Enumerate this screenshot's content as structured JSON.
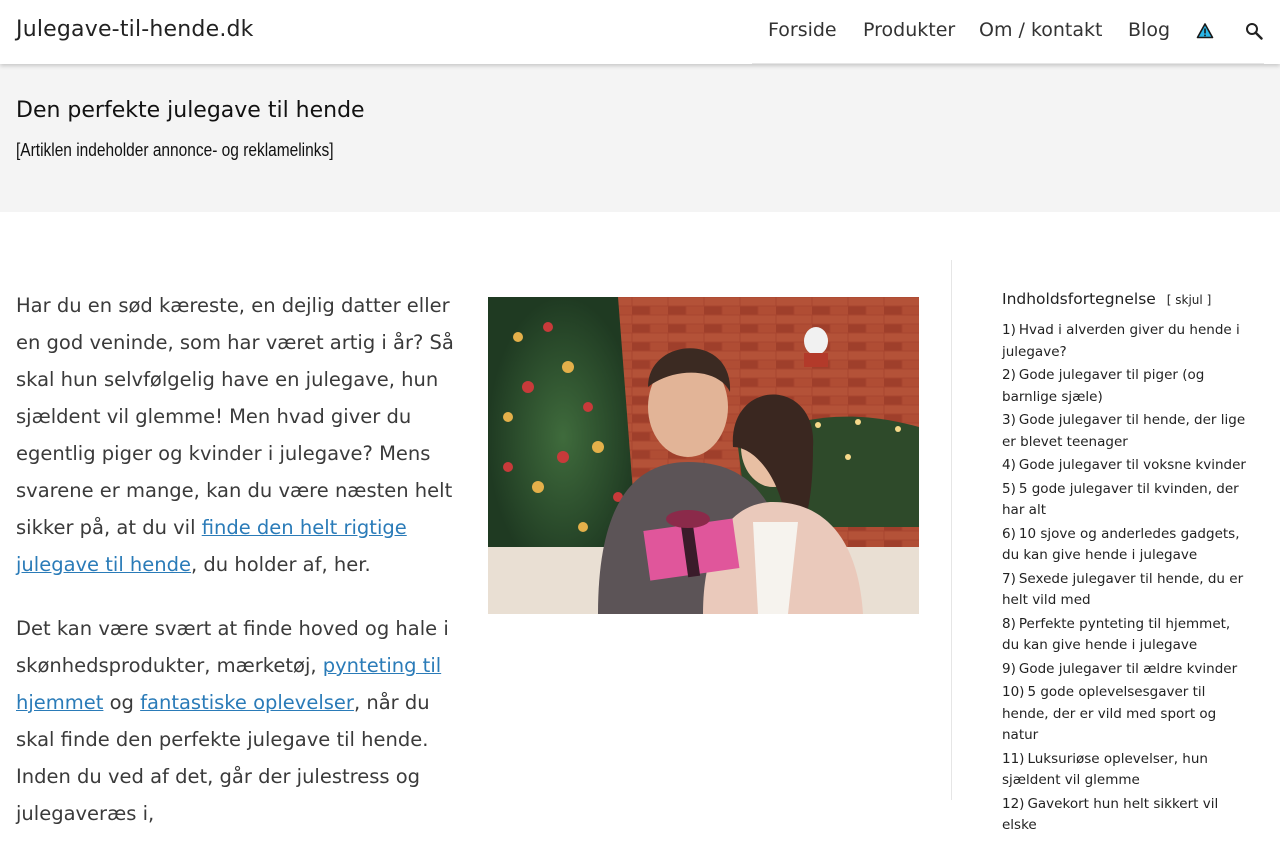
{
  "header": {
    "site_title": "Julegave-til-hende.dk",
    "nav": [
      "Forside",
      "Produkter",
      "Om / kontakt",
      "Blog"
    ],
    "icons": [
      "warning-triangle-icon",
      "search-icon"
    ]
  },
  "hero": {
    "title": "Den perfekte julegave til hende",
    "note": "[Artiklen indeholder annonce- og reklamelinks]"
  },
  "article": {
    "p1_text": "Har du en sød kæreste, en dejlig datter eller en god veninde, som har været artig i år? Så skal hun selvfølgelig have en julegave, hun sjældent vil glemme! Men hvad giver du egentlig piger og kvinder i julegave? Mens svarene er mange, kan du være næsten helt sikker på, at du vil ",
    "p1_link": "finde den helt rigtige julegave til hende",
    "p1_end": ", du holder af, her.",
    "p2_start": "Det kan være svært at finde hoved og hale i skønhedsprodukter, mærketøj, ",
    "p2_link1": "pynteting til hjemmet",
    "p2_mid": " og ",
    "p2_link2": "fantastiske oplevelser",
    "p2_end": ", når du skal finde den perfekte julegave til hende. Inden du ved af det, går der julestress og julegaveræs i,"
  },
  "toc": {
    "title": "Indholdsfortegnelse",
    "toggle_open": "[",
    "toggle_label": "skjul",
    "toggle_close": "]",
    "items": [
      {
        "num": "1)",
        "label": "Hvad i alverden giver du hende i julegave?"
      },
      {
        "num": "2)",
        "label": "Gode julegaver til piger (og barnlige sjæle)"
      },
      {
        "num": "3)",
        "label": "Gode julegaver til hende, der lige er blevet teenager"
      },
      {
        "num": "4)",
        "label": "Gode julegaver til voksne kvinder"
      },
      {
        "num": "5)",
        "label": "5 gode julegaver til kvinden, der har alt"
      },
      {
        "num": "6)",
        "label": "10 sjove og anderledes gadgets, du kan give hende i julegave"
      },
      {
        "num": "7)",
        "label": "Sexede julegaver til hende, du er helt vild med"
      },
      {
        "num": "8)",
        "label": "Perfekte pynteting til hjemmet, du kan give hende i julegave"
      },
      {
        "num": "9)",
        "label": "Gode julegaver til ældre kvinder"
      },
      {
        "num": "10)",
        "label": "5 gode oplevelsesgaver til hende, der er vild med sport og natur"
      },
      {
        "num": "11)",
        "label": "Luksuriøse oplevelser, hun sjældent vil glemme"
      },
      {
        "num": "12)",
        "label": "Gavekort hun helt sikkert vil elske"
      }
    ]
  },
  "colors": {
    "link": "#2a7bb8",
    "hero_band": "#f4f4f4",
    "warning_icon_fill": "#29b6e8"
  }
}
